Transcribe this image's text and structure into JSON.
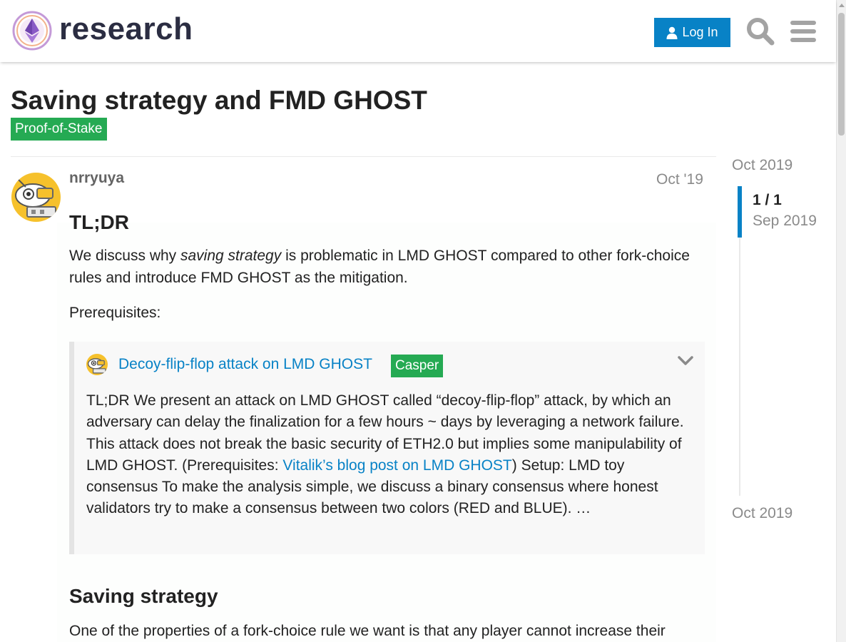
{
  "header": {
    "site_name": "research",
    "login_label": "Log In"
  },
  "topic": {
    "title": "Saving strategy and FMD GHOST",
    "category": "Proof-of-Stake"
  },
  "post": {
    "username": "nrryuya",
    "date": "Oct '19",
    "heading_tldr": "TL;DR",
    "para1_before": "We discuss why ",
    "para1_em": "saving strategy",
    "para1_after": " is problematic in LMD GHOST compared to other fork-choice rules and introduce FMD GHOST as the mitigation.",
    "prerequisites": "Prerequisites:",
    "onebox": {
      "title": "Decoy-flip-flop attack on LMD GHOST",
      "category": "Casper",
      "text_before_link": "TL;DR We present an attack on LMD GHOST called “decoy-flip-flop” attack, by which an adversary can delay the finalization for a few hours ~ days by leveraging a network failure. This attack does not break the basic security of ETH2.0 but implies some manipulability of LMD GHOST. (Prerequisites: ",
      "link_text": "Vitalik’s blog post on LMD GHOST",
      "text_after_link": ") Setup: LMD toy consensus To make the analysis simple, we discuss a binary consensus where honest validators try to make a consensus between two colors (RED and BLUE). …"
    },
    "heading_saving": "Saving strategy",
    "para2": "One of the properties of a fork-choice rule we want is that any player cannot increase their"
  },
  "timeline": {
    "start_label": "Oct 2019",
    "counter": "1 / 1",
    "current_date": "Sep 2019",
    "end_label": "Oct 2019"
  },
  "colors": {
    "accent": "#0882c6",
    "badge_green": "#25aa53"
  },
  "icons": [
    "research-logo",
    "user-icon",
    "search-icon",
    "hamburger-menu-icon",
    "chevron-down-icon"
  ]
}
